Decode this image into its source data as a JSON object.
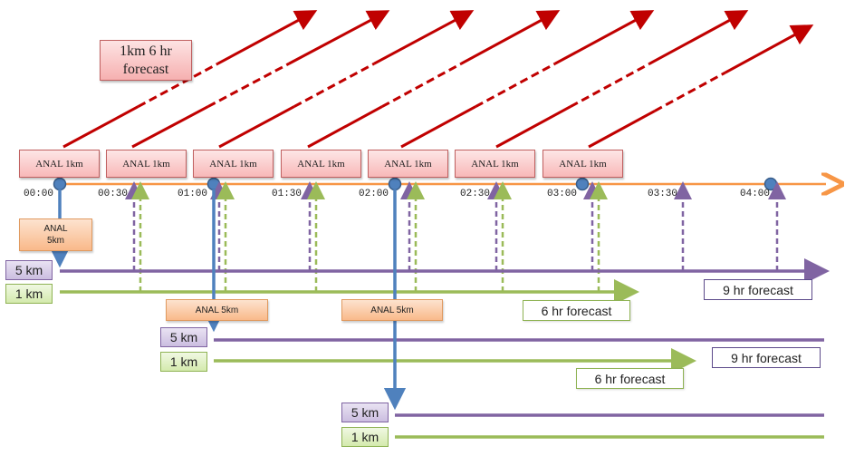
{
  "title_box": {
    "line1": "1km 6 hr",
    "line2": "forecast"
  },
  "anal_1km_label": "ANAL 1km",
  "anal_1km_boxes": [
    "ANAL 1km",
    "ANAL 1km",
    "ANAL 1km",
    "ANAL 1km",
    "ANAL 1km",
    "ANAL 1km",
    "ANAL 1km"
  ],
  "time_ticks": [
    "00:00",
    "00:30",
    "01:00",
    "01:30",
    "02:00",
    "02:30",
    "03:00",
    "03:30",
    "04:00"
  ],
  "anal_5km": [
    {
      "line1": "ANAL",
      "line2": "5km"
    },
    {
      "line1": "ANAL 5km",
      "line2": ""
    },
    {
      "line1": "ANAL 5km",
      "line2": ""
    }
  ],
  "resolutions": {
    "r5": "5 km",
    "r1": "1 km"
  },
  "forecasts": {
    "f9": "9 hr forecast",
    "f6": "6 hr forecast"
  },
  "colors": {
    "red_arrow": "#c00000",
    "timeline": "#f79646",
    "analysis_5km": "#4f81bd",
    "run_5km": "#8064a2",
    "run_1km": "#9bbb59"
  }
}
